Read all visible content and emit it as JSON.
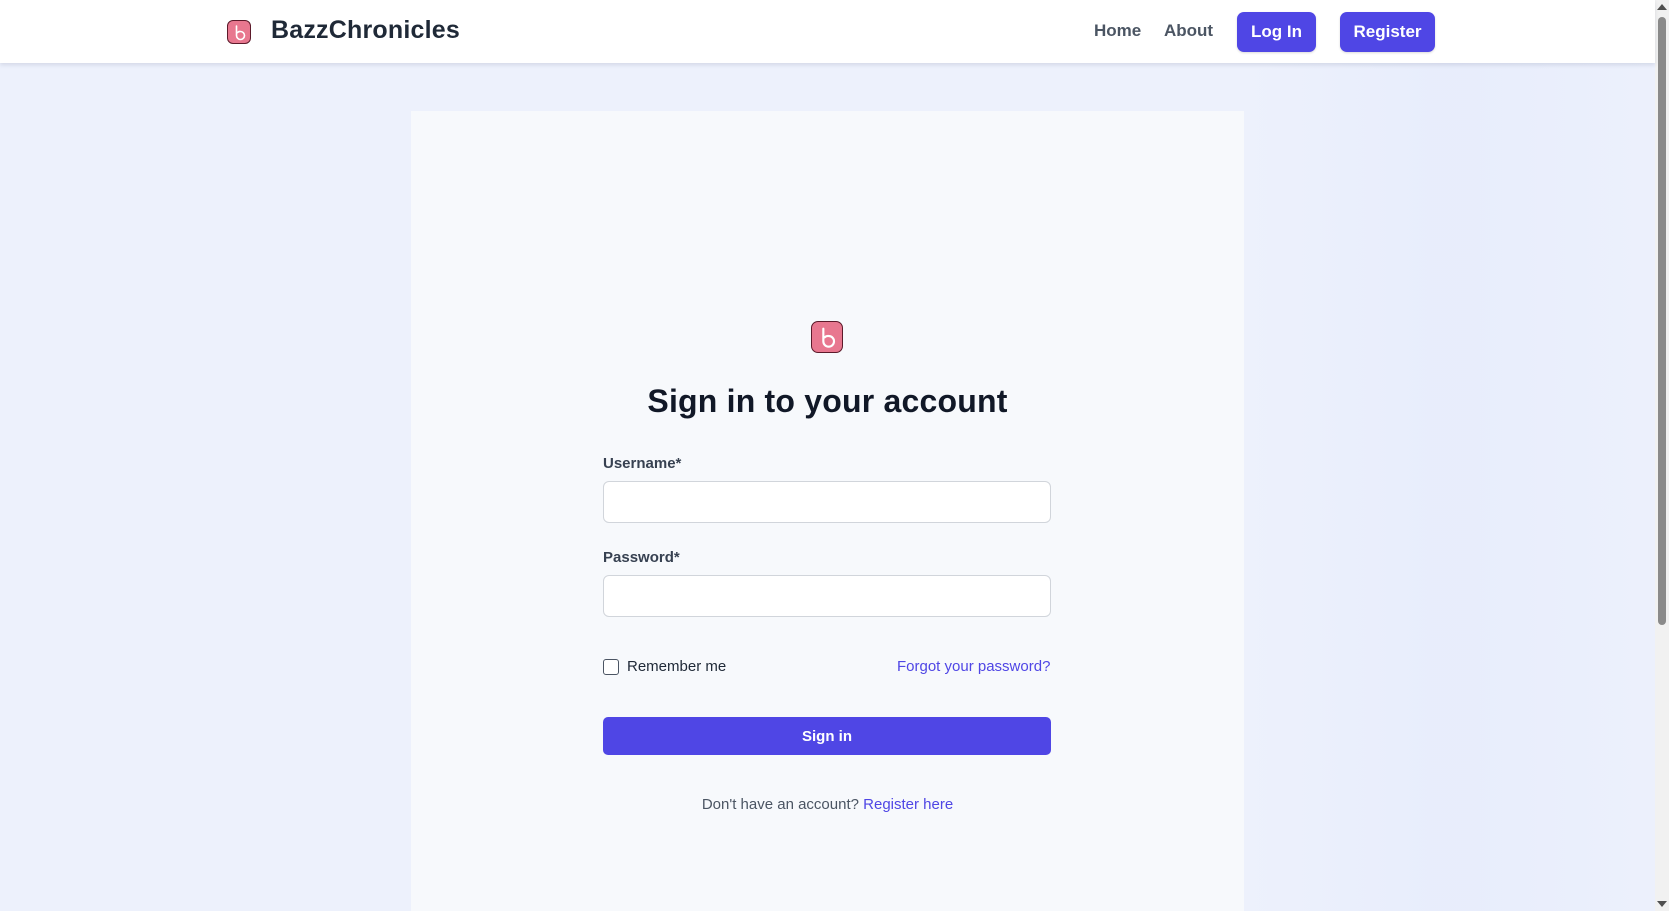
{
  "header": {
    "brand_name": "BazzChronicles",
    "logo_icon": "bazz-logo-icon",
    "nav": {
      "home": "Home",
      "about": "About",
      "login": "Log In",
      "register": "Register"
    }
  },
  "login_form": {
    "title": "Sign in to your account",
    "username_label": "Username*",
    "username_value": "",
    "password_label": "Password*",
    "password_value": "",
    "remember_label": "Remember me",
    "remember_checked": false,
    "forgot_link": "Forgot your password?",
    "submit_label": "Sign in",
    "register_prompt": "Don't have an account?",
    "register_link": "Register here"
  },
  "colors": {
    "accent": "#4f46e5",
    "page_background": "#edf1fc",
    "card_background": "#f7f9fc",
    "logo_pink": "#e8778f"
  }
}
